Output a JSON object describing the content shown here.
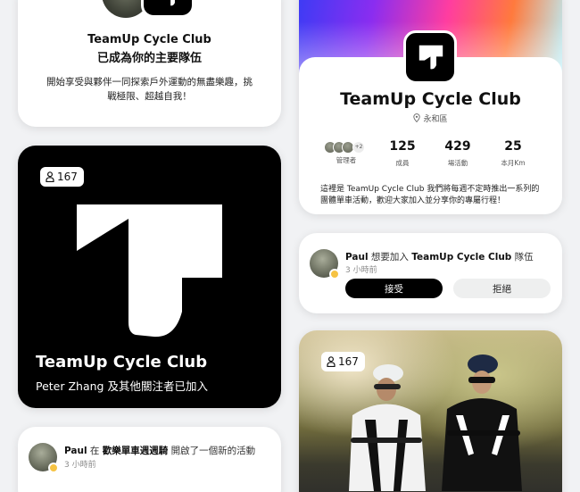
{
  "primary_team_card": {
    "club_name": "TeamUp Cycle Club",
    "status_line": "已成為你的主要隊伍",
    "message": "開始享受與夥伴一同探索戶外運動的無盡樂趣，挑戰極限、超越自我！"
  },
  "logo_tile": {
    "member_count": "167",
    "club_name": "TeamUp Cycle Club",
    "followers_line": "Peter Zhang  及其他關注者已加入"
  },
  "activity_card": {
    "user": "Paul",
    "connector": " 在 ",
    "target": "歡樂單車週週騎",
    "action": " 開啟了一個新的活動",
    "time": "3 小時前"
  },
  "club_profile": {
    "club_name": "TeamUp Cycle Club",
    "location": "永和區",
    "admin_extra": "+2",
    "stats": [
      {
        "value": "",
        "label": "管理者"
      },
      {
        "value": "125",
        "label": "成員"
      },
      {
        "value": "429",
        "label": "場活動"
      },
      {
        "value": "25",
        "label": "本月Km"
      }
    ],
    "description": "這裡是 TeamUp Cycle Club 我們將每週不定時推出一系列的團體單車活動，歡迎大家加入並分享你的專屬行程！"
  },
  "join_request": {
    "user": "Paul",
    "action": " 想要加入 ",
    "target": "TeamUp Cycle Club",
    "suffix": " 隊伍",
    "time": "3 小時前",
    "accept_label": "接受",
    "reject_label": "拒絕"
  },
  "photo_card": {
    "member_count": "167"
  },
  "colors": {
    "background": "#f1f2f4",
    "accent": "#000000",
    "verified_badge": "#f6c343"
  }
}
